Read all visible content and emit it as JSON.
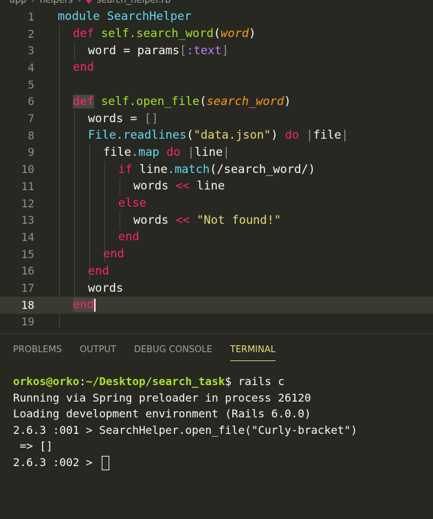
{
  "breadcrumb": {
    "parts": [
      "app",
      "helpers",
      "search_helper.rb"
    ],
    "icon": "ruby-gem-icon"
  },
  "editor": {
    "line_numbers": [
      "1",
      "2",
      "3",
      "4",
      "5",
      "6",
      "7",
      "8",
      "9",
      "10",
      "11",
      "12",
      "13",
      "14",
      "15",
      "16",
      "17",
      "18",
      "19"
    ],
    "current_line": "18",
    "tokens": {
      "l1": [
        "module",
        " ",
        "SearchHelper"
      ],
      "l2": [
        "def",
        " ",
        "self",
        ".",
        "search_word",
        "(",
        "word",
        ")"
      ],
      "l3": [
        "word",
        " = ",
        "params",
        "[",
        ":text",
        "]"
      ],
      "l4": [
        "end"
      ],
      "l6": [
        "def",
        " ",
        "self",
        ".",
        "open_file",
        "(",
        "search_word",
        ")"
      ],
      "l7": [
        "words",
        " = ",
        "[]"
      ],
      "l8": [
        "File",
        ".",
        "readlines",
        "(",
        "\"data.json\"",
        ")",
        " ",
        "do",
        " ",
        "|",
        "file",
        "|"
      ],
      "l9": [
        "file",
        ".",
        "map",
        " ",
        "do",
        " ",
        "|",
        "line",
        "|"
      ],
      "l10": [
        "if",
        " ",
        "line",
        ".",
        "match",
        "(",
        "/search_word/",
        ")"
      ],
      "l11": [
        "words",
        " ",
        "<<",
        " ",
        "line"
      ],
      "l12": [
        "else"
      ],
      "l13": [
        "words",
        " ",
        "<<",
        " ",
        "\"Not found!\""
      ],
      "l14": [
        "end"
      ],
      "l15": [
        "end"
      ],
      "l16": [
        "end"
      ],
      "l17": [
        "words"
      ],
      "l18": [
        "end"
      ]
    }
  },
  "panel": {
    "tabs": [
      "PROBLEMS",
      "OUTPUT",
      "DEBUG CONSOLE",
      "TERMINAL"
    ],
    "active_tab": "TERMINAL",
    "terminal": {
      "prompt_user": "orkos@orko",
      "prompt_sep": ":",
      "prompt_path": "~/Desktop/search_task",
      "prompt_end": "$ ",
      "command": "rails c",
      "lines": [
        "Running via Spring preloader in process 26120",
        "Loading development environment (Rails 6.0.0)",
        "2.6.3 :001 > SearchHelper.open_file(\"Curly-bracket\")",
        " => []",
        "2.6.3 :002 > "
      ]
    }
  }
}
